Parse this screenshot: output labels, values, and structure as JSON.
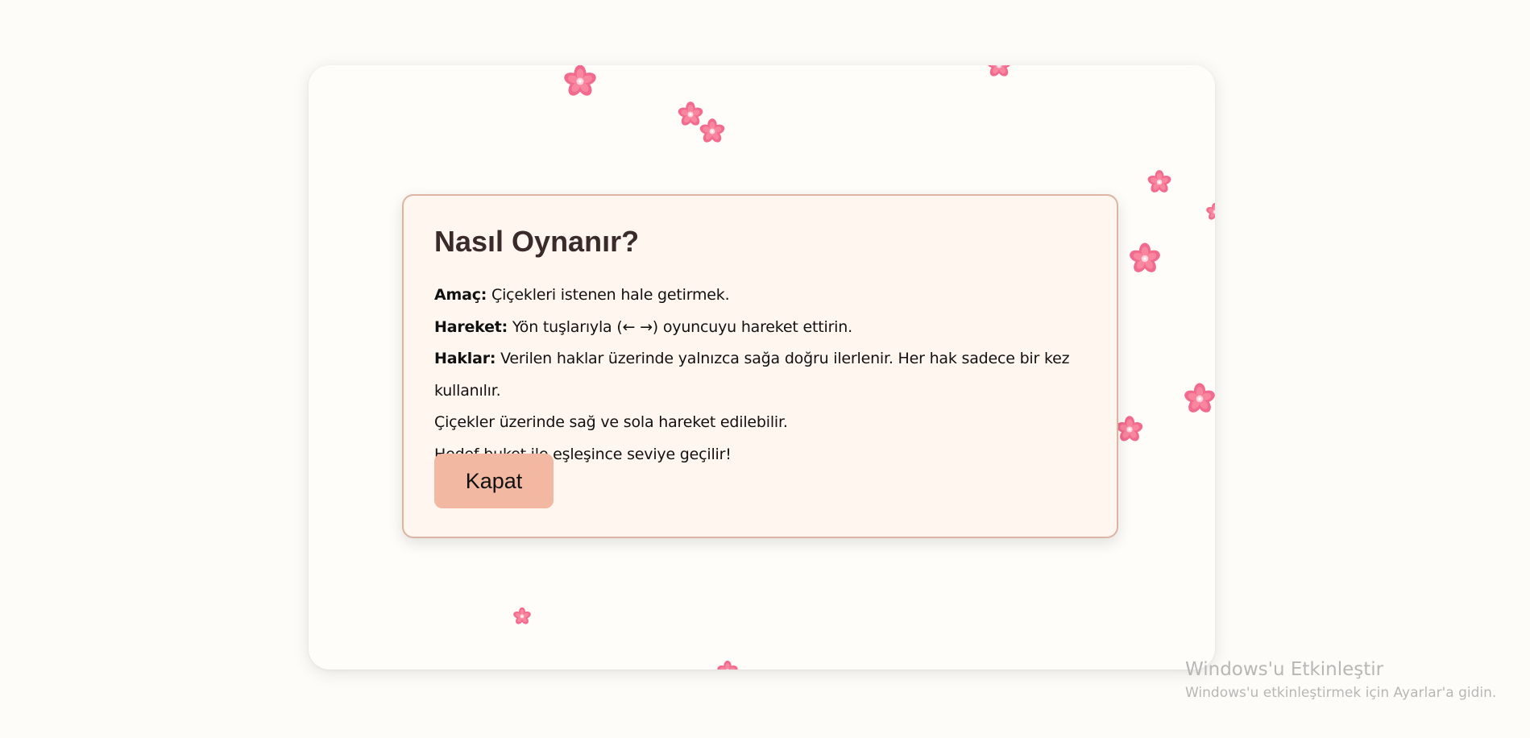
{
  "modal": {
    "title": "Nasıl Oynanır?",
    "lines": [
      {
        "label": "Amaç:",
        "text": " Çiçekleri istenen hale getirmek."
      },
      {
        "label": "Hareket:",
        "text": " Yön tuşlarıyla (← →) oyuncuyu hareket ettirin."
      },
      {
        "label": "Haklar:",
        "text": " Verilen haklar üzerinde yalnızca sağa doğru ilerlenir. Her hak sadece bir kez kullanılır."
      },
      {
        "label": "",
        "text": "Çiçekler üzerinde sağ ve sola hareket edilebilir."
      },
      {
        "label": "",
        "text": "Hedef buket ile eşleşince seviye geçilir!"
      }
    ],
    "close_label": "Kapat"
  },
  "watermark": {
    "title": "Windows'u Etkinleştir",
    "subtitle": "Windows'u etkinleştirmek için Ayarlar'a gidin."
  },
  "colors": {
    "page_background": "#fdfcf8",
    "card_background": "#fefdfa",
    "modal_background": "#fff6f0",
    "modal_border": "#deb3a1",
    "button_background": "#f2b8a2",
    "title_color": "#3a2a2a",
    "flower_petal": "#f26a8d",
    "flower_center": "#ffd3de",
    "watermark_text": "#b7b7b7"
  },
  "icons": {
    "flower": "sakura-flower-icon"
  }
}
